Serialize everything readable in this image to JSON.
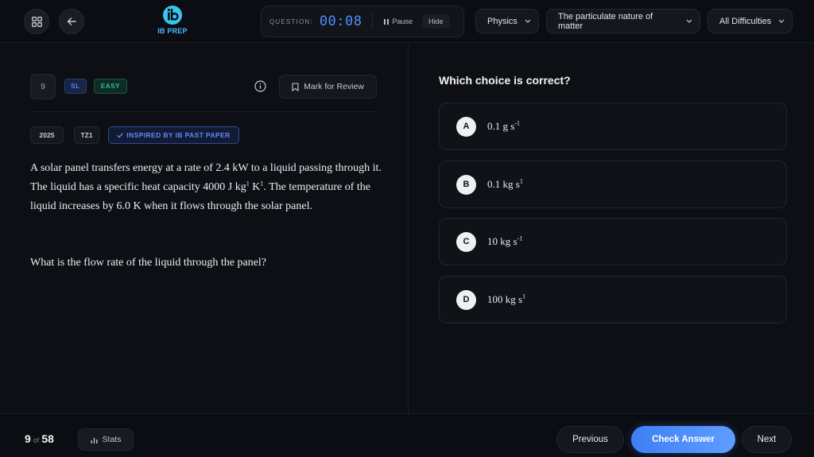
{
  "header": {
    "logo_text": "IB PREP",
    "timer_label": "QUESTION:",
    "timer_value": "00:08",
    "pause_label": "Pause",
    "hide_label": "Hide",
    "subject": "Physics",
    "topic": "The particulate nature of matter",
    "difficulty_filter": "All Difficulties"
  },
  "question": {
    "number": "9",
    "level": "SL",
    "difficulty": "EASY",
    "mark_for_review_label": "Mark for Review",
    "year": "2025",
    "timezone": "TZ1",
    "source_badge": "INSPIRED BY IB PAST PAPER",
    "stem_part1": "A solar panel transfers energy at a rate of 2.4 kW to a liquid passing through it. The liquid has a specific heat capacity 4000 J kg",
    "stem_sup1": "1",
    "stem_part2": " K",
    "stem_sup2": "1",
    "stem_part3": ". The temperature of the liquid increases by 6.0 K when it flows through the solar panel.",
    "ask": "What is the flow rate of the liquid through the panel?"
  },
  "answers": {
    "prompt": "Which choice is correct?",
    "choices": [
      {
        "letter": "A",
        "text": "0.1 g s",
        "sup": "-1"
      },
      {
        "letter": "B",
        "text": "0.1 kg s",
        "sup": "1"
      },
      {
        "letter": "C",
        "text": "10 kg s",
        "sup": "-1"
      },
      {
        "letter": "D",
        "text": "100 kg s",
        "sup": "1"
      }
    ]
  },
  "footer": {
    "current": "9",
    "of_label": "of",
    "total": "58",
    "stats_label": "Stats",
    "previous_label": "Previous",
    "check_label": "Check Answer",
    "next_label": "Next"
  },
  "colors": {
    "accent": "#4f8fff",
    "background": "#0d0f14",
    "easy": "#33c38f",
    "logo": "#37c6f0"
  },
  "icons": {
    "grid": "grid-icon",
    "back": "arrow-left-icon",
    "info": "info-icon",
    "bookmark": "bookmark-icon",
    "stats": "bar-chart-icon",
    "check": "check-icon"
  }
}
